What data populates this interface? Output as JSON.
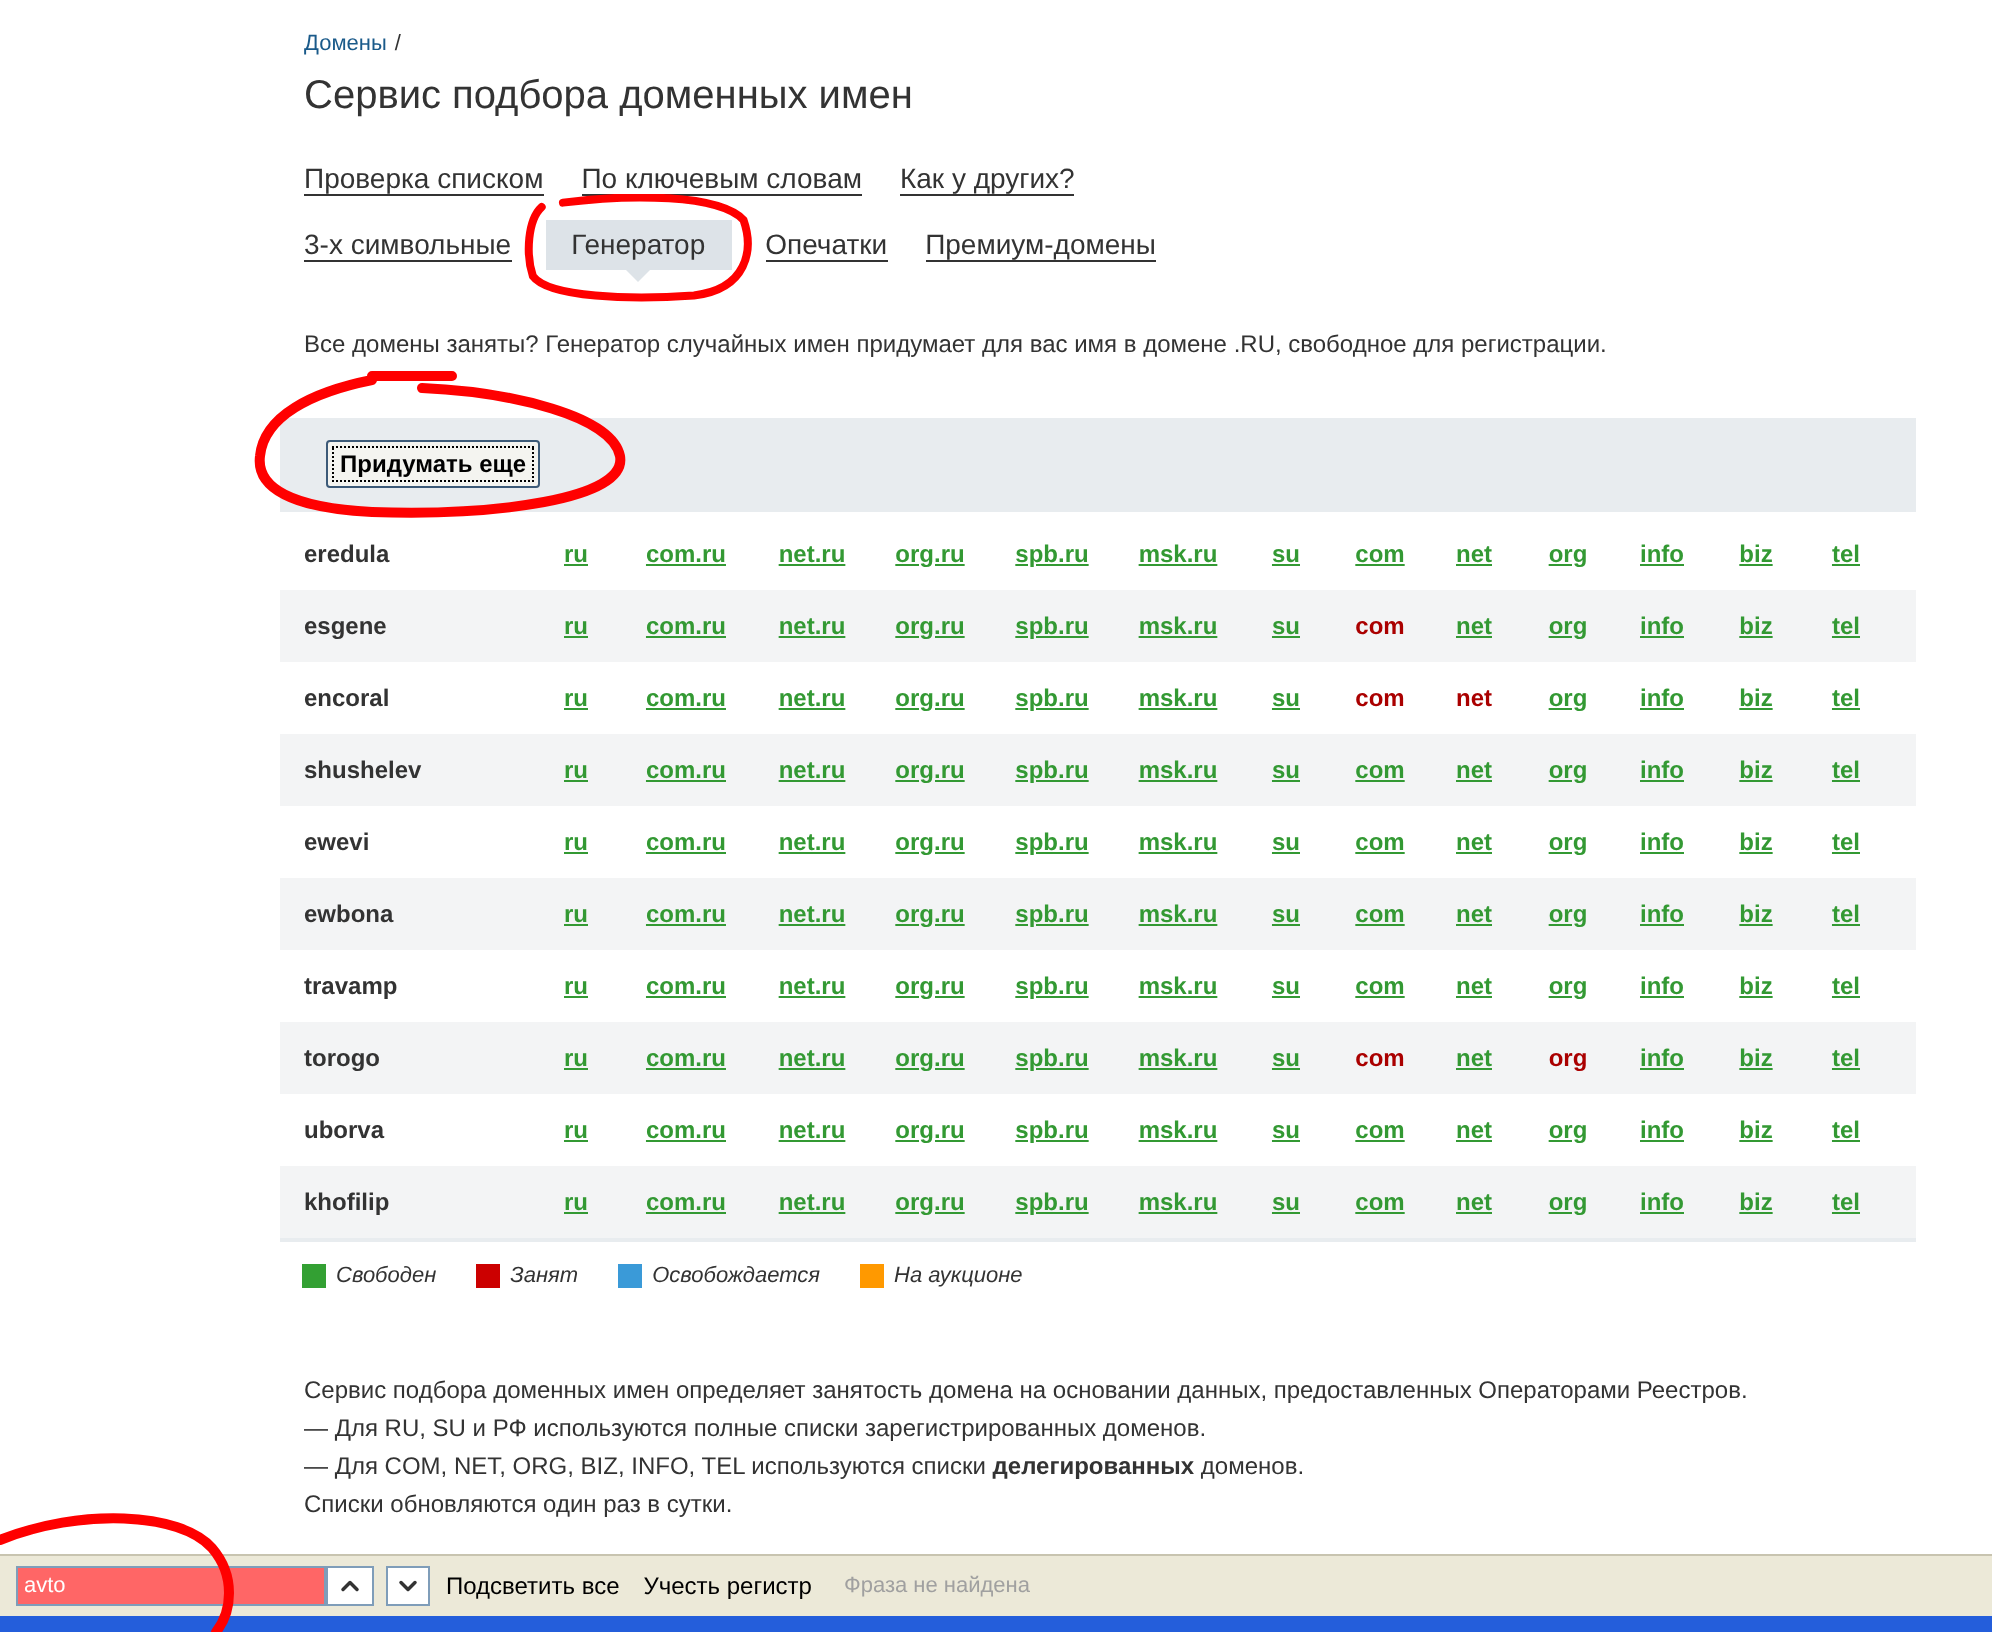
{
  "breadcrumb": {
    "link": "Домены",
    "separator": "/"
  },
  "title": "Сервис подбора доменных имен",
  "nav_rows": [
    [
      {
        "label": "Проверка списком",
        "selected": false
      },
      {
        "label": "По ключевым словам",
        "selected": false
      },
      {
        "label": "Как у других?",
        "selected": false
      }
    ],
    [
      {
        "label": "3-х символьные",
        "selected": false
      },
      {
        "label": "Генератор",
        "selected": true
      },
      {
        "label": "Опечатки",
        "selected": false
      },
      {
        "label": "Премиум-домены",
        "selected": false
      }
    ]
  ],
  "intro": "Все домены заняты? Генератор случайных имен придумает для вас имя в домене .RU, свободное для регистрации.",
  "generate_button": "Придумать еще",
  "rows": [
    {
      "name": "eredula",
      "cells": [
        {
          "label": "ru",
          "taken": false
        },
        {
          "label": "com.ru",
          "taken": false
        },
        {
          "label": "net.ru",
          "taken": false
        },
        {
          "label": "org.ru",
          "taken": false
        },
        {
          "label": "spb.ru",
          "taken": false
        },
        {
          "label": "msk.ru",
          "taken": false
        },
        {
          "label": "su",
          "taken": false
        },
        {
          "label": "com",
          "taken": false
        },
        {
          "label": "net",
          "taken": false
        },
        {
          "label": "org",
          "taken": false
        },
        {
          "label": "info",
          "taken": false
        },
        {
          "label": "biz",
          "taken": false
        },
        {
          "label": "tel",
          "taken": false
        }
      ]
    },
    {
      "name": "esgene",
      "cells": [
        {
          "label": "ru",
          "taken": false
        },
        {
          "label": "com.ru",
          "taken": false
        },
        {
          "label": "net.ru",
          "taken": false
        },
        {
          "label": "org.ru",
          "taken": false
        },
        {
          "label": "spb.ru",
          "taken": false
        },
        {
          "label": "msk.ru",
          "taken": false
        },
        {
          "label": "su",
          "taken": false
        },
        {
          "label": "com",
          "taken": true
        },
        {
          "label": "net",
          "taken": false
        },
        {
          "label": "org",
          "taken": false
        },
        {
          "label": "info",
          "taken": false
        },
        {
          "label": "biz",
          "taken": false
        },
        {
          "label": "tel",
          "taken": false
        }
      ]
    },
    {
      "name": "encoral",
      "cells": [
        {
          "label": "ru",
          "taken": false
        },
        {
          "label": "com.ru",
          "taken": false
        },
        {
          "label": "net.ru",
          "taken": false
        },
        {
          "label": "org.ru",
          "taken": false
        },
        {
          "label": "spb.ru",
          "taken": false
        },
        {
          "label": "msk.ru",
          "taken": false
        },
        {
          "label": "su",
          "taken": false
        },
        {
          "label": "com",
          "taken": true
        },
        {
          "label": "net",
          "taken": true
        },
        {
          "label": "org",
          "taken": false
        },
        {
          "label": "info",
          "taken": false
        },
        {
          "label": "biz",
          "taken": false
        },
        {
          "label": "tel",
          "taken": false
        }
      ]
    },
    {
      "name": "shushelev",
      "cells": [
        {
          "label": "ru",
          "taken": false
        },
        {
          "label": "com.ru",
          "taken": false
        },
        {
          "label": "net.ru",
          "taken": false
        },
        {
          "label": "org.ru",
          "taken": false
        },
        {
          "label": "spb.ru",
          "taken": false
        },
        {
          "label": "msk.ru",
          "taken": false
        },
        {
          "label": "su",
          "taken": false
        },
        {
          "label": "com",
          "taken": false
        },
        {
          "label": "net",
          "taken": false
        },
        {
          "label": "org",
          "taken": false
        },
        {
          "label": "info",
          "taken": false
        },
        {
          "label": "biz",
          "taken": false
        },
        {
          "label": "tel",
          "taken": false
        }
      ]
    },
    {
      "name": "ewevi",
      "cells": [
        {
          "label": "ru",
          "taken": false
        },
        {
          "label": "com.ru",
          "taken": false
        },
        {
          "label": "net.ru",
          "taken": false
        },
        {
          "label": "org.ru",
          "taken": false
        },
        {
          "label": "spb.ru",
          "taken": false
        },
        {
          "label": "msk.ru",
          "taken": false
        },
        {
          "label": "su",
          "taken": false
        },
        {
          "label": "com",
          "taken": false
        },
        {
          "label": "net",
          "taken": false
        },
        {
          "label": "org",
          "taken": false
        },
        {
          "label": "info",
          "taken": false
        },
        {
          "label": "biz",
          "taken": false
        },
        {
          "label": "tel",
          "taken": false
        }
      ]
    },
    {
      "name": "ewbona",
      "cells": [
        {
          "label": "ru",
          "taken": false
        },
        {
          "label": "com.ru",
          "taken": false
        },
        {
          "label": "net.ru",
          "taken": false
        },
        {
          "label": "org.ru",
          "taken": false
        },
        {
          "label": "spb.ru",
          "taken": false
        },
        {
          "label": "msk.ru",
          "taken": false
        },
        {
          "label": "su",
          "taken": false
        },
        {
          "label": "com",
          "taken": false
        },
        {
          "label": "net",
          "taken": false
        },
        {
          "label": "org",
          "taken": false
        },
        {
          "label": "info",
          "taken": false
        },
        {
          "label": "biz",
          "taken": false
        },
        {
          "label": "tel",
          "taken": false
        }
      ]
    },
    {
      "name": "travamp",
      "cells": [
        {
          "label": "ru",
          "taken": false
        },
        {
          "label": "com.ru",
          "taken": false
        },
        {
          "label": "net.ru",
          "taken": false
        },
        {
          "label": "org.ru",
          "taken": false
        },
        {
          "label": "spb.ru",
          "taken": false
        },
        {
          "label": "msk.ru",
          "taken": false
        },
        {
          "label": "su",
          "taken": false
        },
        {
          "label": "com",
          "taken": false
        },
        {
          "label": "net",
          "taken": false
        },
        {
          "label": "org",
          "taken": false
        },
        {
          "label": "info",
          "taken": false
        },
        {
          "label": "biz",
          "taken": false
        },
        {
          "label": "tel",
          "taken": false
        }
      ]
    },
    {
      "name": "torogo",
      "cells": [
        {
          "label": "ru",
          "taken": false
        },
        {
          "label": "com.ru",
          "taken": false
        },
        {
          "label": "net.ru",
          "taken": false
        },
        {
          "label": "org.ru",
          "taken": false
        },
        {
          "label": "spb.ru",
          "taken": false
        },
        {
          "label": "msk.ru",
          "taken": false
        },
        {
          "label": "su",
          "taken": false
        },
        {
          "label": "com",
          "taken": true
        },
        {
          "label": "net",
          "taken": false
        },
        {
          "label": "org",
          "taken": true
        },
        {
          "label": "info",
          "taken": false
        },
        {
          "label": "biz",
          "taken": false
        },
        {
          "label": "tel",
          "taken": false
        }
      ]
    },
    {
      "name": "uborva",
      "cells": [
        {
          "label": "ru",
          "taken": false
        },
        {
          "label": "com.ru",
          "taken": false
        },
        {
          "label": "net.ru",
          "taken": false
        },
        {
          "label": "org.ru",
          "taken": false
        },
        {
          "label": "spb.ru",
          "taken": false
        },
        {
          "label": "msk.ru",
          "taken": false
        },
        {
          "label": "su",
          "taken": false
        },
        {
          "label": "com",
          "taken": false
        },
        {
          "label": "net",
          "taken": false
        },
        {
          "label": "org",
          "taken": false
        },
        {
          "label": "info",
          "taken": false
        },
        {
          "label": "biz",
          "taken": false
        },
        {
          "label": "tel",
          "taken": false
        }
      ]
    },
    {
      "name": "khofilip",
      "cells": [
        {
          "label": "ru",
          "taken": false
        },
        {
          "label": "com.ru",
          "taken": false
        },
        {
          "label": "net.ru",
          "taken": false
        },
        {
          "label": "org.ru",
          "taken": false
        },
        {
          "label": "spb.ru",
          "taken": false
        },
        {
          "label": "msk.ru",
          "taken": false
        },
        {
          "label": "su",
          "taken": false
        },
        {
          "label": "com",
          "taken": false
        },
        {
          "label": "net",
          "taken": false
        },
        {
          "label": "org",
          "taken": false
        },
        {
          "label": "info",
          "taken": false
        },
        {
          "label": "biz",
          "taken": false
        },
        {
          "label": "tel",
          "taken": false
        }
      ]
    }
  ],
  "legend": [
    {
      "label": "Свободен",
      "color": "#33a033"
    },
    {
      "label": "Занят",
      "color": "#cc0000"
    },
    {
      "label": "Освобождается",
      "color": "#3a9ad8"
    },
    {
      "label": "На аукционе",
      "color": "#ff9900"
    }
  ],
  "notes": [
    "Сервис подбора доменных имен определяет занятость домена на основании данных, предоставленных Операторами Реестров.",
    "— Для RU, SU и РФ используются полные списки зарегистрированных доменов.",
    "— Для COM, NET, ORG, BIZ, INFO, TEL используются списки **делегированных** доменов.",
    "Списки обновляются один раз в сутки."
  ],
  "find_bar": {
    "value": "avto",
    "found": false,
    "highlight_all": "Подсветить все",
    "match_case": "Учесть регистр",
    "status": "Фраза не найдена"
  }
}
